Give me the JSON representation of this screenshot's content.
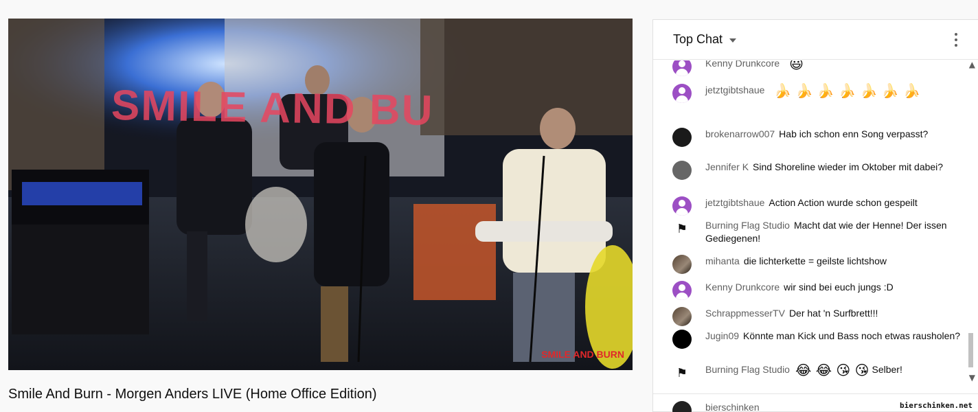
{
  "video": {
    "title": "Smile And Burn - Morgen Anders LIVE (Home Office Edition)",
    "watermark": "SMILE AND BURN"
  },
  "chat": {
    "header": "Top Chat",
    "messages": [
      {
        "author": "Kenny Drunkcore",
        "text": "",
        "emoji": "😃"
      },
      {
        "author": "jetztgibtshaue",
        "text": "",
        "emoji": "🍌 🍌 🍌 🍌 🍌 🍌 🍌"
      },
      {
        "author": "brokenarrow007",
        "text": "Hab ich schon enn Song verpasst?"
      },
      {
        "author": "Jennifer K",
        "text": "Sind Shoreline wieder im Oktober mit dabei?"
      },
      {
        "author": "jetztgibtshaue",
        "text": "Action Action wurde schon gespeilt"
      },
      {
        "author": "Burning Flag Studio",
        "text": "Macht dat wie der Henne! Der issen Gediegenen!"
      },
      {
        "author": "mihanta",
        "text": "die lichterkette = geilste lichtshow"
      },
      {
        "author": "Kenny Drunkcore",
        "text": "wir sind bei euch jungs :D"
      },
      {
        "author": "SchrappmesserTV",
        "text": "Der hat 'n Surfbrett!!!"
      },
      {
        "author": "Jugin09",
        "text": "Könnte man Kick und Bass noch etwas rausholen?"
      },
      {
        "author": "Burning Flag Studio",
        "text": "Selber!",
        "emoji": "😂 😂 😘 😘"
      }
    ],
    "footer_author": "bierschinken",
    "overlay_site": "bierschinken.net"
  }
}
